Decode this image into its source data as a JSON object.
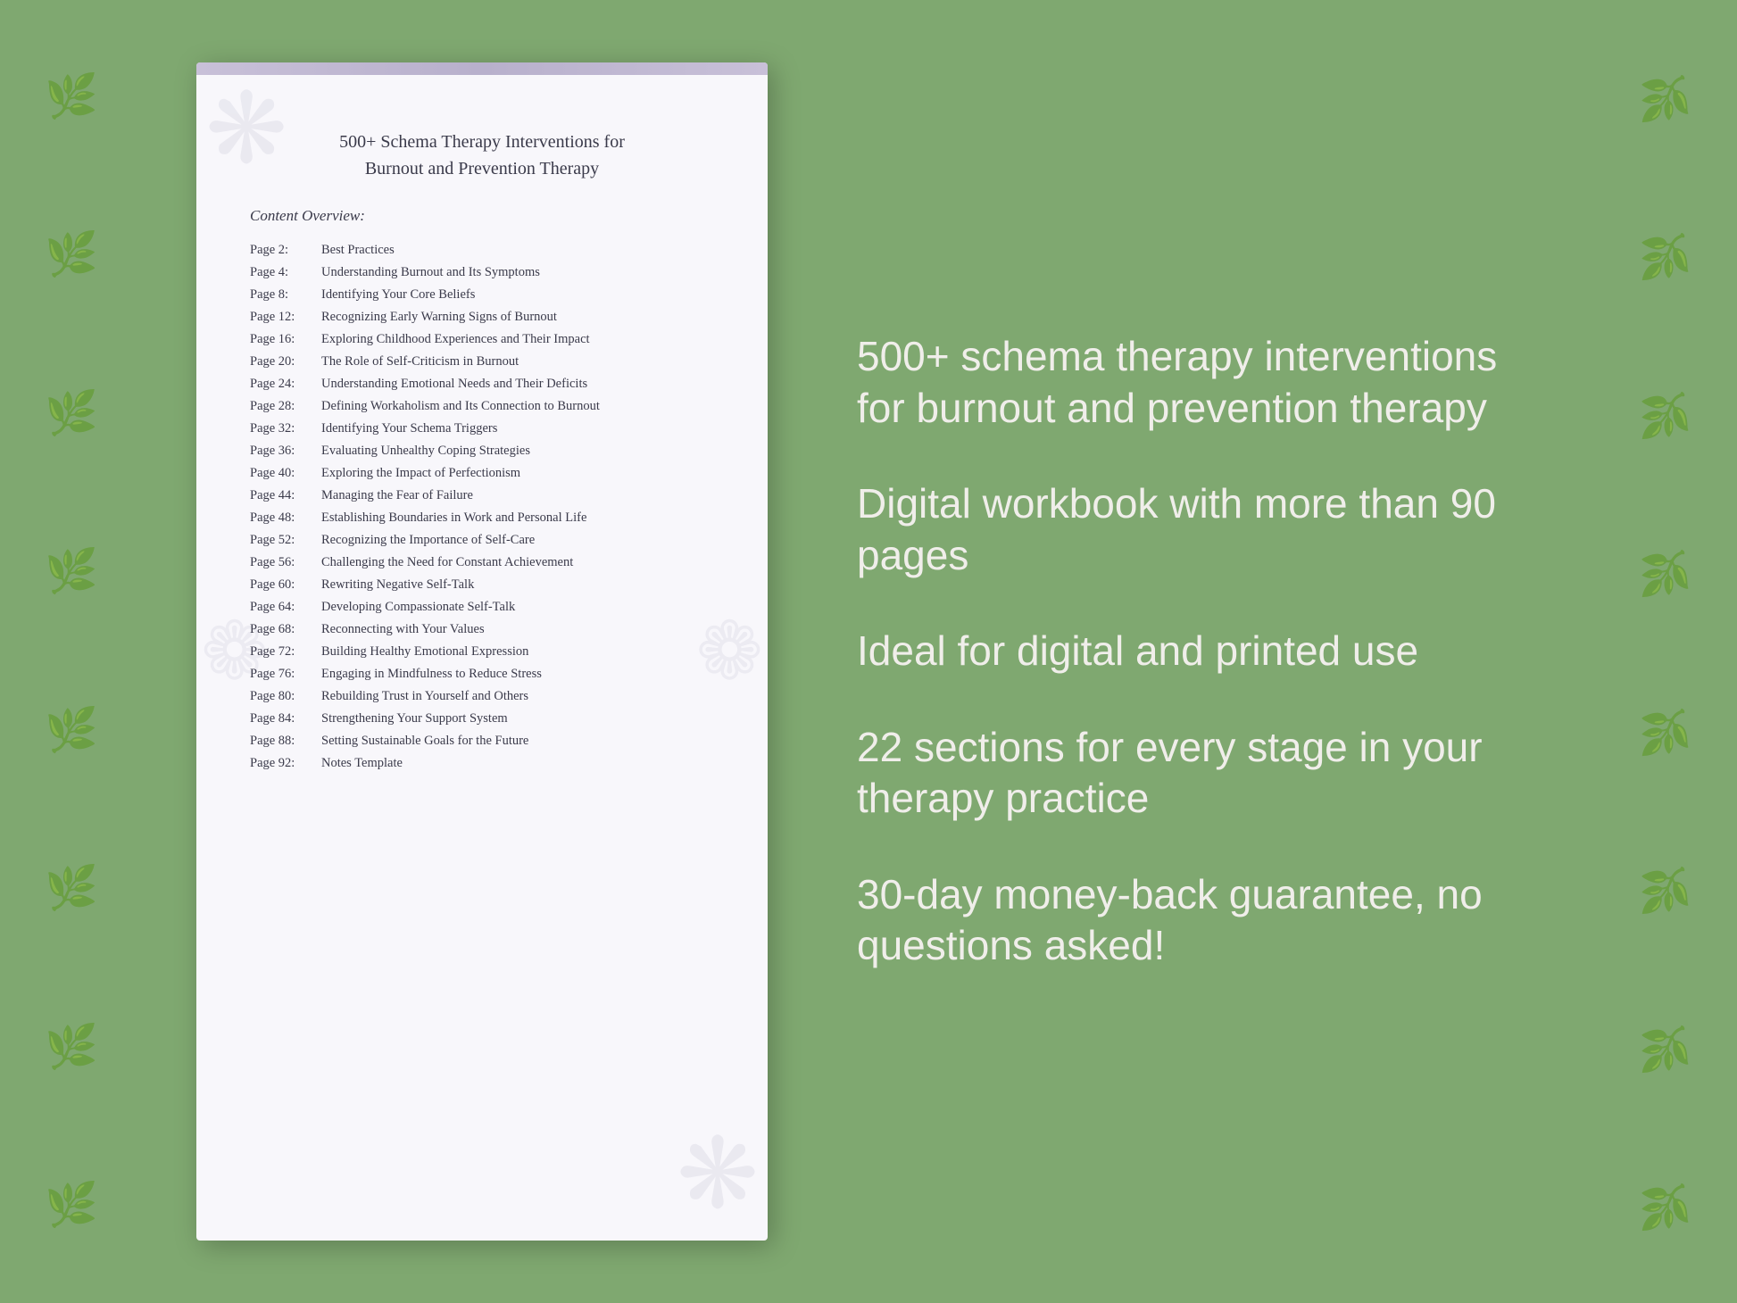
{
  "background": {
    "color": "#7fa870"
  },
  "document": {
    "title_line1": "500+ Schema Therapy Interventions for",
    "title_line2": "Burnout and Prevention Therapy",
    "content_overview_label": "Content Overview:",
    "toc": [
      {
        "page": "Page  2:",
        "title": "Best Practices"
      },
      {
        "page": "Page  4:",
        "title": "Understanding Burnout and Its Symptoms"
      },
      {
        "page": "Page  8:",
        "title": "Identifying Your Core Beliefs"
      },
      {
        "page": "Page 12:",
        "title": "Recognizing Early Warning Signs of Burnout"
      },
      {
        "page": "Page 16:",
        "title": "Exploring Childhood Experiences and Their Impact"
      },
      {
        "page": "Page 20:",
        "title": "The Role of Self-Criticism in Burnout"
      },
      {
        "page": "Page 24:",
        "title": "Understanding Emotional Needs and Their Deficits"
      },
      {
        "page": "Page 28:",
        "title": "Defining Workaholism and Its Connection to Burnout"
      },
      {
        "page": "Page 32:",
        "title": "Identifying Your Schema Triggers"
      },
      {
        "page": "Page 36:",
        "title": "Evaluating Unhealthy Coping Strategies"
      },
      {
        "page": "Page 40:",
        "title": "Exploring the Impact of Perfectionism"
      },
      {
        "page": "Page 44:",
        "title": "Managing the Fear of Failure"
      },
      {
        "page": "Page 48:",
        "title": "Establishing Boundaries in Work and Personal Life"
      },
      {
        "page": "Page 52:",
        "title": "Recognizing the Importance of Self-Care"
      },
      {
        "page": "Page 56:",
        "title": "Challenging the Need for Constant Achievement"
      },
      {
        "page": "Page 60:",
        "title": "Rewriting Negative Self-Talk"
      },
      {
        "page": "Page 64:",
        "title": "Developing Compassionate Self-Talk"
      },
      {
        "page": "Page 68:",
        "title": "Reconnecting with Your Values"
      },
      {
        "page": "Page 72:",
        "title": "Building Healthy Emotional Expression"
      },
      {
        "page": "Page 76:",
        "title": "Engaging in Mindfulness to Reduce Stress"
      },
      {
        "page": "Page 80:",
        "title": "Rebuilding Trust in Yourself and Others"
      },
      {
        "page": "Page 84:",
        "title": "Strengthening Your Support System"
      },
      {
        "page": "Page 88:",
        "title": "Setting Sustainable Goals for the Future"
      },
      {
        "page": "Page 92:",
        "title": "Notes Template"
      }
    ]
  },
  "features": [
    "500+ schema therapy interventions for burnout and prevention therapy",
    "Digital workbook with more than 90 pages",
    "Ideal for digital and printed use",
    "22 sections for every stage in your therapy practice",
    "30-day money-back guarantee, no questions asked!"
  ]
}
